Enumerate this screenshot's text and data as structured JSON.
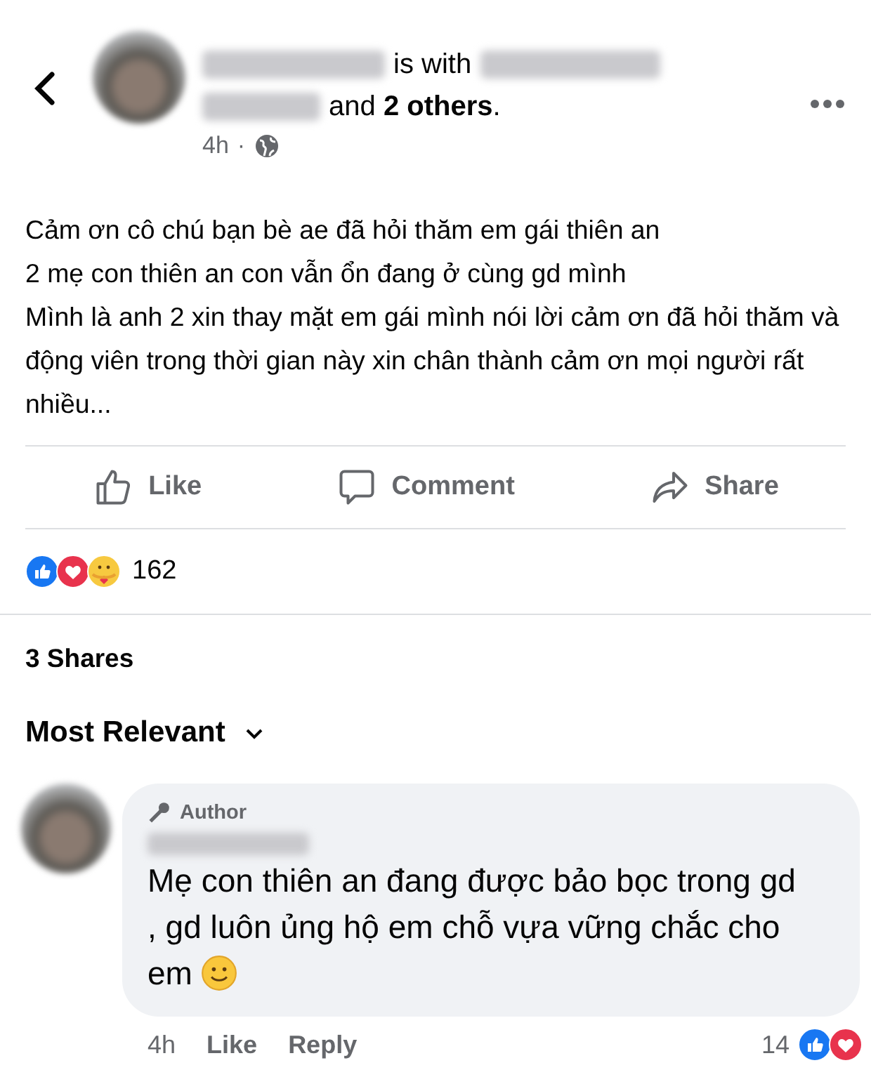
{
  "post": {
    "with_text": "is with",
    "others_text": "and **2 others**.",
    "time": "4h",
    "separator": "·",
    "public_audience": true,
    "body_lines": [
      "Cảm ơn cô chú bạn bè ae đã hỏi thăm em gái thiên an",
      "2 mẹ con thiên an con vẫn ổn đang ở cùng gd mình",
      "Mình là anh 2 xin thay mặt em gái mình nói lời cảm ơn đã hỏi thăm và động viên trong thời gian này xin chân thành cảm ơn mọi người rất nhiều..."
    ]
  },
  "actions": [
    {
      "kind": "like",
      "label": "Like"
    },
    {
      "kind": "comment",
      "label": "Comment"
    },
    {
      "kind": "share",
      "label": "Share"
    }
  ],
  "reactions": {
    "types": [
      {
        "kind": "like"
      },
      {
        "kind": "love"
      },
      {
        "kind": "care"
      }
    ],
    "count": "162"
  },
  "shares": "3 Shares",
  "sort": {
    "label": "Most Relevant"
  },
  "comment": {
    "badge": "Author",
    "text": "Mẹ con thiên an đang được bảo bọc trong gd , gd luôn ủng hộ em chỗ vựa vững chắc cho em",
    "ends_with_smile": true,
    "time": "4h",
    "like": "Like",
    "reply": "Reply",
    "reaction_count": "14",
    "reactions": [
      {
        "kind": "like"
      },
      {
        "kind": "love"
      }
    ]
  }
}
